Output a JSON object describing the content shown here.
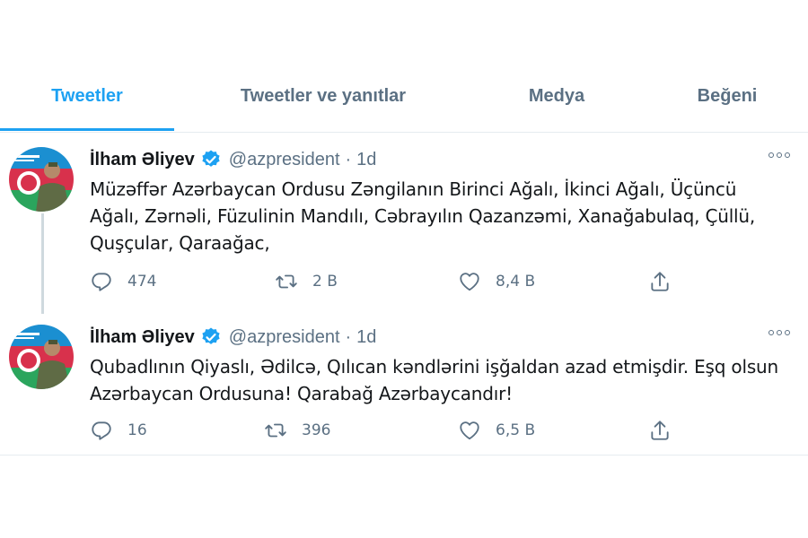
{
  "tabs": [
    "Tweetler",
    "Tweetler ve yanıtlar",
    "Medya",
    "Beğeni"
  ],
  "tweets": [
    {
      "author": {
        "name": "İlham Əliyev",
        "handle": "@azpresident",
        "verified": true
      },
      "time": "1d",
      "separator": "·",
      "text": "Müzəffər Azərbaycan Ordusu Zəngilanın Birinci Ağalı, İkinci Ağalı, Üçüncü Ağalı, Zərnəli, Füzulinin Mandılı, Cəbrayılın Qazanzəmi, Xanağabulaq, Çüllü, Quşçular, Qaraağac,",
      "replies": "474",
      "retweets": "2 B",
      "likes": "8,4 B"
    },
    {
      "author": {
        "name": "İlham Əliyev",
        "handle": "@azpresident",
        "verified": true
      },
      "time": "1d",
      "separator": "·",
      "text": "Qubadlının Qiyaslı, Ədilcə, Qılıcan kəndlərini işğaldan azad etmişdir. Eşq olsun Azərbaycan Ordusuna! Qarabağ Azərbaycandır!",
      "replies": "16",
      "retweets": "396",
      "likes": "6,5 B"
    }
  ],
  "colors": {
    "accent": "#1da1f2",
    "secondary_text": "#5b7083",
    "primary_text": "#14171a",
    "divider": "#e6ecf0"
  },
  "icons": [
    "reply-icon",
    "retweet-icon",
    "like-icon",
    "share-icon",
    "verified-badge-icon",
    "more-options-icon"
  ]
}
